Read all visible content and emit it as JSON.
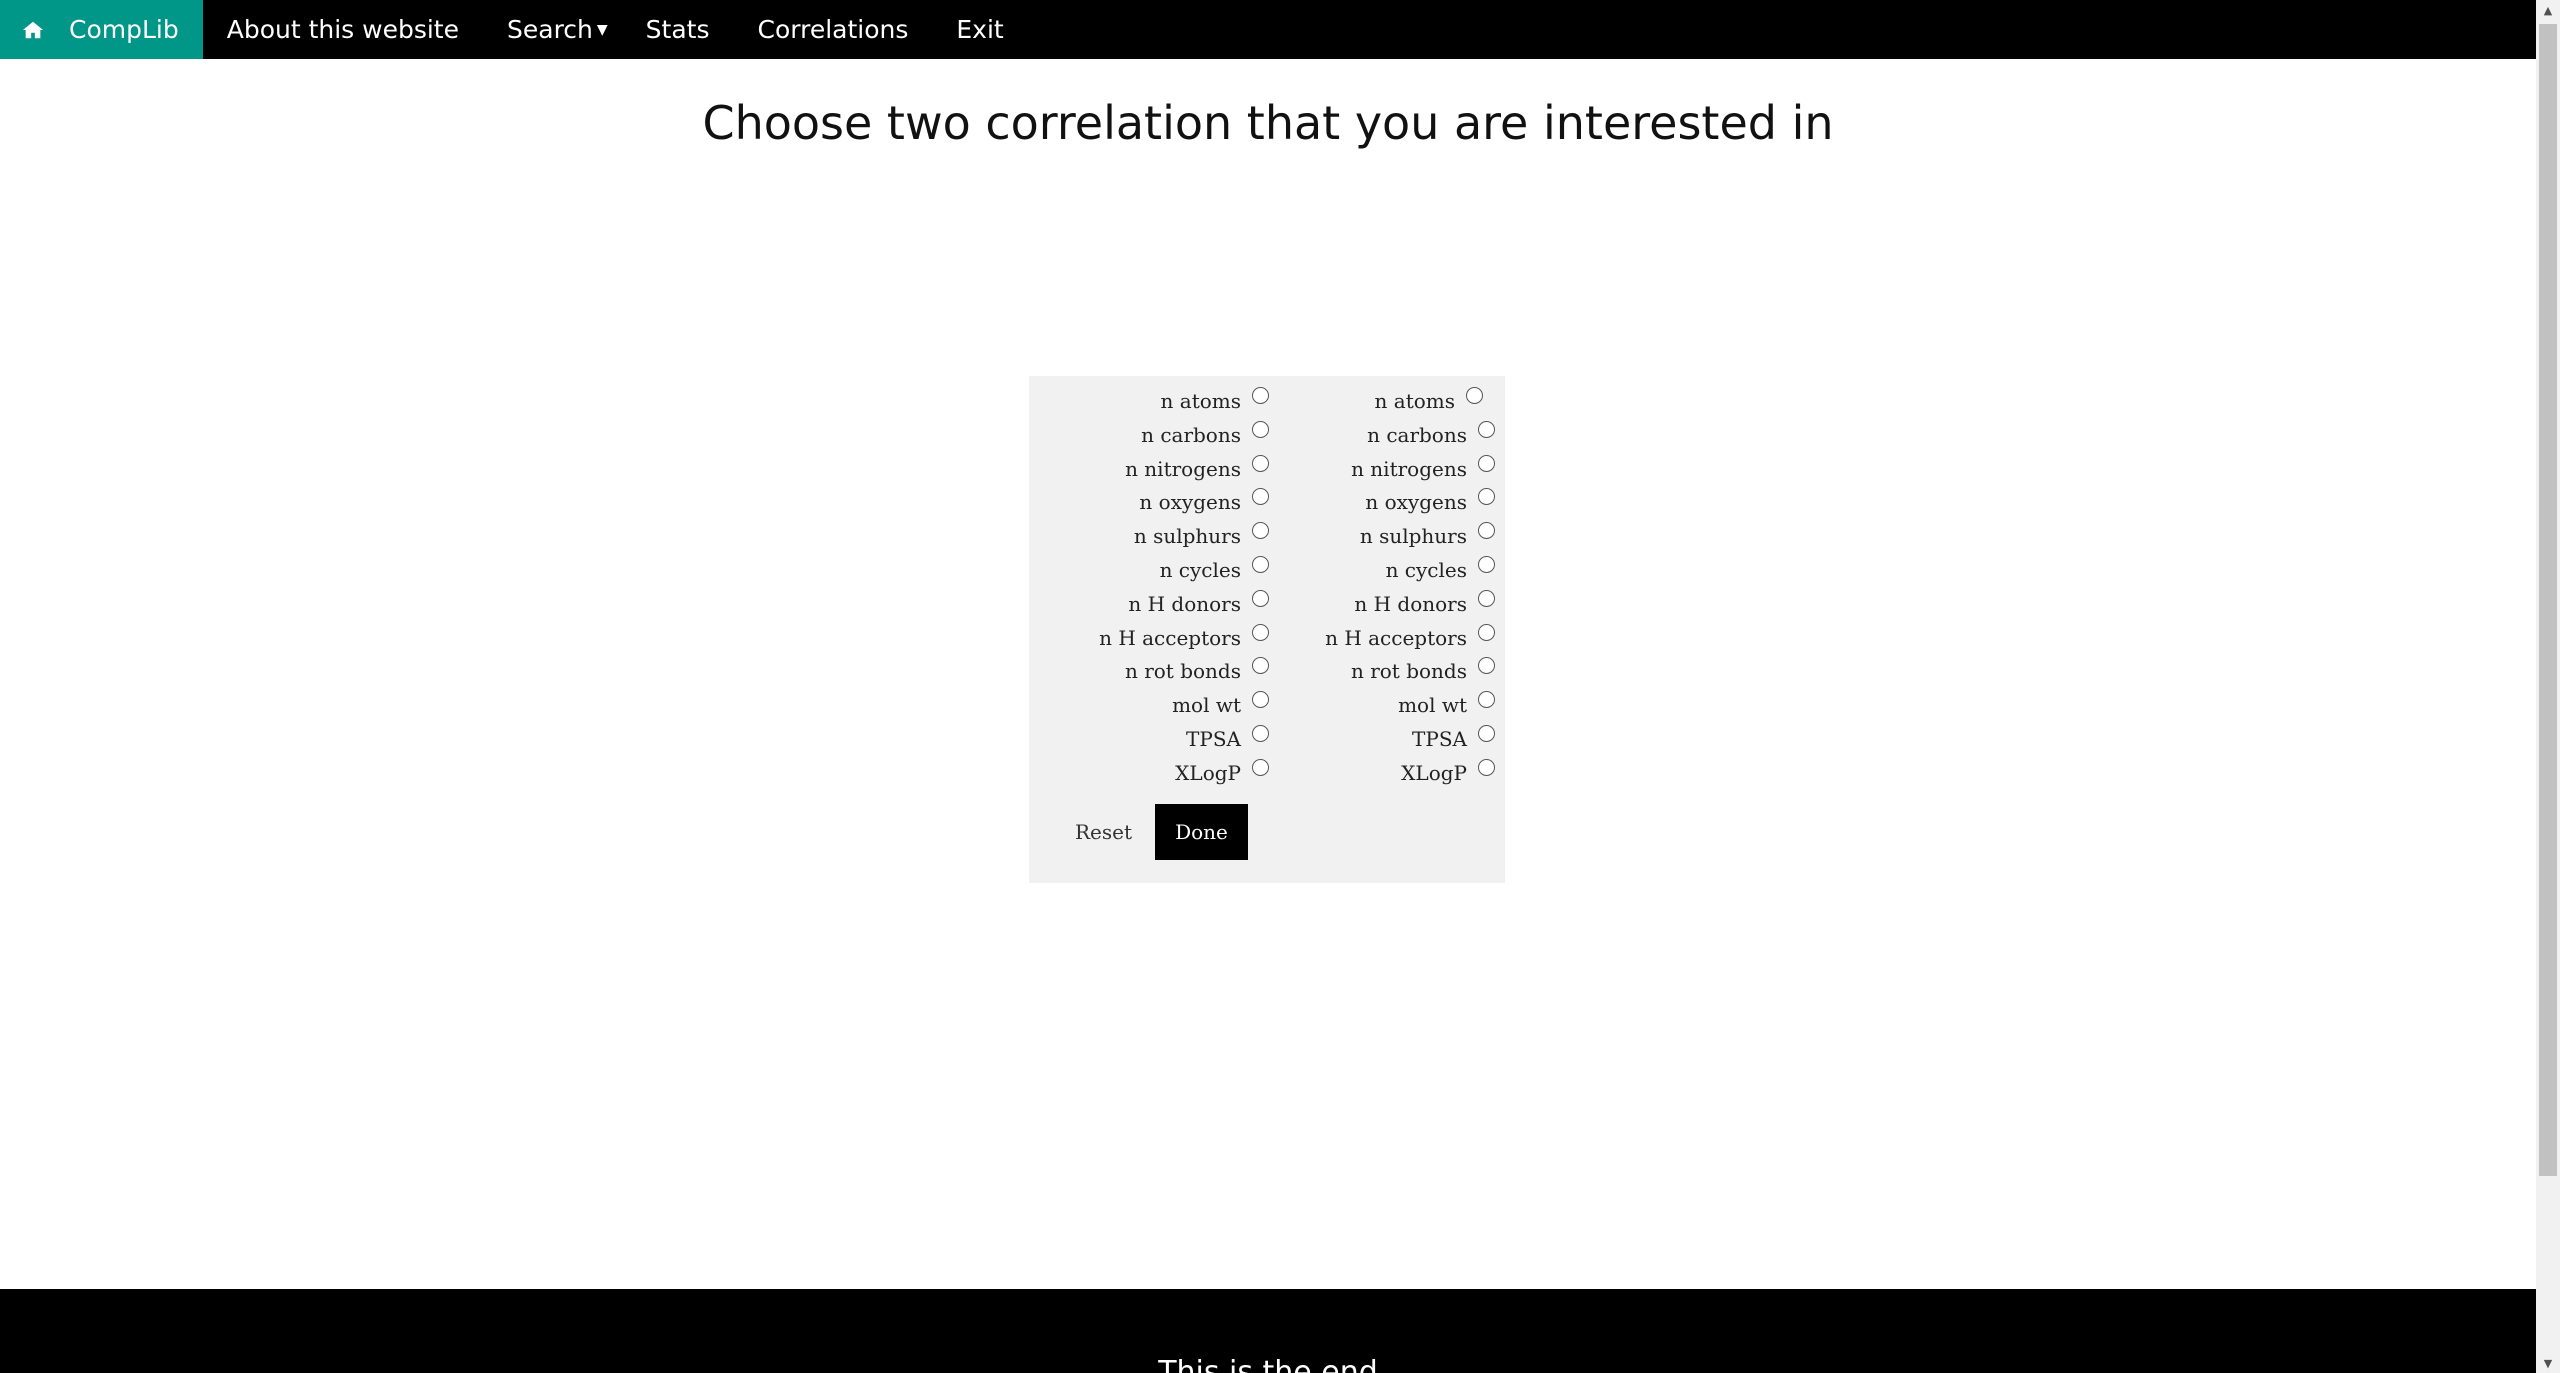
{
  "nav": {
    "home_label": "CompLib",
    "items": [
      "About this website",
      "Search",
      "Stats",
      "Correlations",
      "Exit"
    ]
  },
  "page_title": "Choose two correlation that you are interested in",
  "form": {
    "left_options": [
      "n atoms",
      "n carbons",
      "n nitrogens",
      "n oxygens",
      "n sulphurs",
      "n cycles",
      "n H donors",
      "n H acceptors",
      "n rot bonds",
      "mol wt",
      "TPSA",
      "XLogP"
    ],
    "right_options": [
      "n atoms",
      "n carbons",
      "n nitrogens",
      "n oxygens",
      "n sulphurs",
      "n cycles",
      "n H donors",
      "n H acceptors",
      "n rot bonds",
      "mol wt",
      "TPSA",
      "XLogP"
    ],
    "reset_label": "Reset",
    "done_label": "Done"
  },
  "footer": {
    "text": "This is the end"
  },
  "colors": {
    "brand": "#009688",
    "navbar": "#000000",
    "panel": "#f1f1f1"
  }
}
